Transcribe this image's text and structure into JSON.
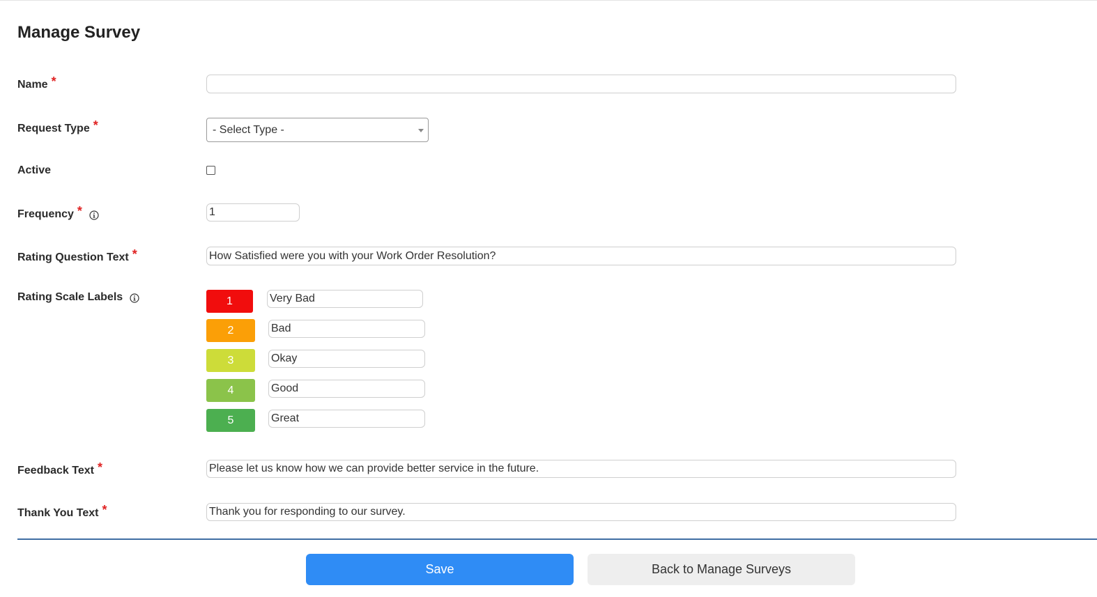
{
  "page": {
    "title": "Manage Survey"
  },
  "form": {
    "name": {
      "label": "Name",
      "required_mark": "*",
      "value": ""
    },
    "request_type": {
      "label": "Request Type",
      "required_mark": "*",
      "selected": "- Select Type -"
    },
    "active": {
      "label": "Active",
      "checked": false
    },
    "frequency": {
      "label": "Frequency",
      "required_mark": "*",
      "value": "1"
    },
    "rating_question": {
      "label": "Rating Question Text",
      "required_mark": "*",
      "value": "How Satisfied were you with your Work Order Resolution?"
    },
    "rating_scale": {
      "label": "Rating Scale Labels",
      "levels": [
        {
          "number": "1",
          "label": "Very Bad",
          "color": "#f10d0d"
        },
        {
          "number": "2",
          "label": "Bad",
          "color": "#fb9f07"
        },
        {
          "number": "3",
          "label": "Okay",
          "color": "#cddc39"
        },
        {
          "number": "4",
          "label": "Good",
          "color": "#8bc34a"
        },
        {
          "number": "5",
          "label": "Great",
          "color": "#4caf50"
        }
      ]
    },
    "feedback_text": {
      "label": "Feedback Text",
      "required_mark": "*",
      "value": "Please let us know how we can provide better service in the future."
    },
    "thank_you_text": {
      "label": "Thank You Text",
      "required_mark": "*",
      "value": "Thank you for responding to our survey."
    }
  },
  "actions": {
    "save_label": "Save",
    "back_label": "Back to Manage Surveys",
    "save_color": "#2f8cf5"
  },
  "icons": {
    "info": "info-circle-icon",
    "dropdown": "chevron-down-icon"
  }
}
